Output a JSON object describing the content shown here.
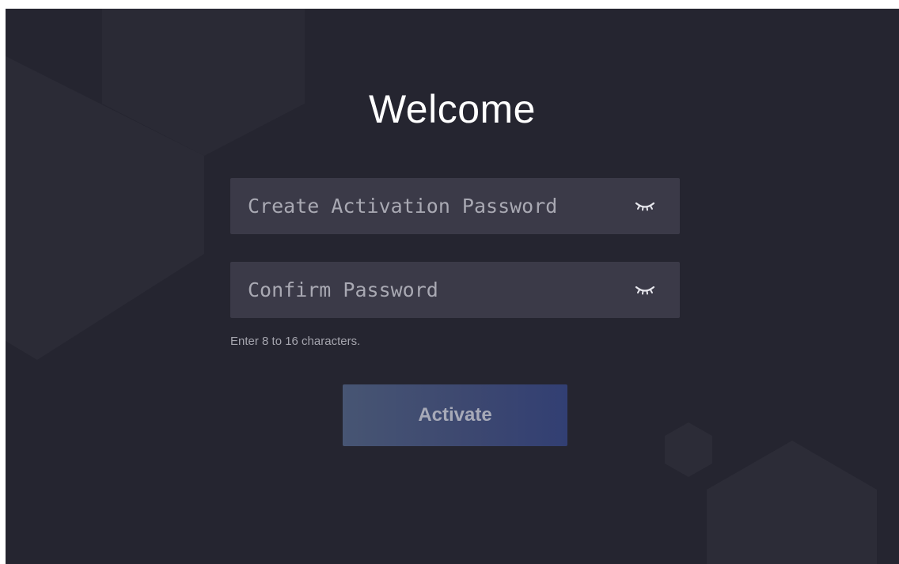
{
  "welcome": {
    "title": "Welcome"
  },
  "form": {
    "password": {
      "placeholder": "Create Activation Password",
      "value": "",
      "toggle_icon": "eye-closed-icon"
    },
    "confirm": {
      "placeholder": "Confirm Password",
      "value": "",
      "toggle_icon": "eye-closed-icon"
    },
    "hint": "Enter 8 to 16 characters.",
    "activate_label": "Activate"
  },
  "colors": {
    "background": "#252530",
    "field_background": "#3b3a48",
    "button_gradient_start": "#475573",
    "button_gradient_end": "#323f73",
    "title": "#ffffff"
  }
}
